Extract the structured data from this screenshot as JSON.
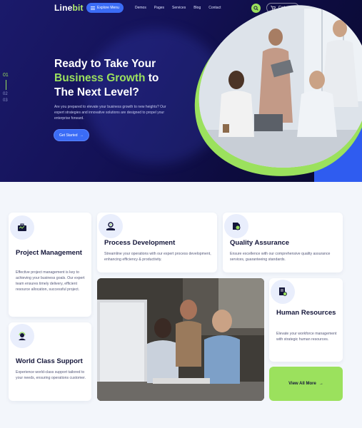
{
  "header": {
    "logo_main": "Line",
    "logo_accent": "bit",
    "explore_label": "Explore Menu",
    "nav": [
      "Demos",
      "Pages",
      "Services",
      "Blog",
      "Contact"
    ],
    "cart_label": "Cart",
    "cart_count": "0"
  },
  "slider": {
    "items": [
      "01",
      "02",
      "03"
    ]
  },
  "hero": {
    "title_line1": "Ready to Take Your",
    "title_highlight": "Business Growth",
    "title_to": " to",
    "title_line3": "The Next Level?",
    "description": "Are you prepared to elevate your business growth to new heights? Our expert strategies and innovative solutions are designed to propel your enterprise forward.",
    "cta_label": "Get Started"
  },
  "cards": [
    {
      "title": "Project Management",
      "text": "Effective project management is key to achieving your business goals. Our expert team ensures timely delivery, efficient resource allocation, successful project.",
      "icon": "briefcase-icon"
    },
    {
      "title": "Process Development",
      "text": "Streamline your operations with our expert process development, enhancing efficiency & productivity.",
      "icon": "gear-hand-icon"
    },
    {
      "title": "Quality Assurance",
      "text": "Ensure excellence with our comprehensive quality assurance services, guaranteeing standards.",
      "icon": "quality-icon"
    },
    {
      "title": "Human Resources",
      "text": "Elevate your workforce management with strategic human resources.",
      "icon": "document-person-icon"
    },
    {
      "title": "World Class Support",
      "text": "Experience world-class support tailored to your needs, ensuring operations customer.",
      "icon": "support-agent-icon"
    }
  ],
  "view_all_label": "View All More",
  "colors": {
    "navy": "#141257",
    "accent_green": "#9be15d",
    "accent_blue": "#3b6cf6"
  }
}
